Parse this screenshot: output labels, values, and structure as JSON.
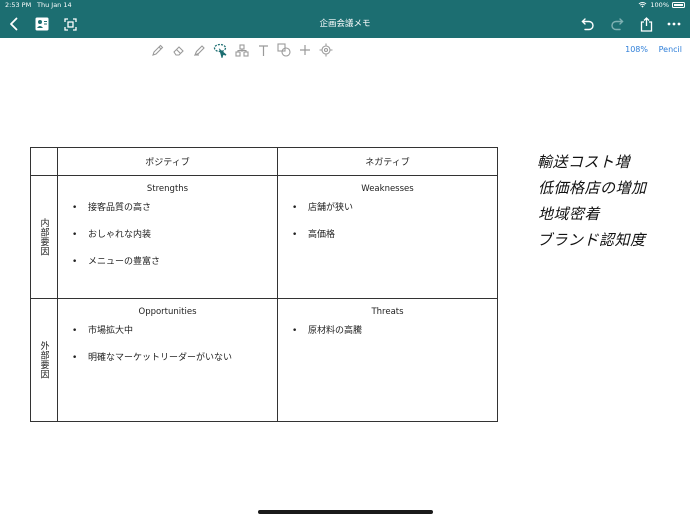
{
  "status_bar": {
    "time": "2:53 PM",
    "date": "Thu Jan 14",
    "battery": "100%"
  },
  "nav": {
    "title": "企画会議メモ",
    "icons": [
      "chevron-left-icon",
      "contacts-icon",
      "fullscreen-icon",
      "undo-icon",
      "redo-icon",
      "share-icon",
      "more-icon"
    ]
  },
  "toolbar": {
    "tools": [
      "pen-icon",
      "eraser-icon",
      "highlighter-icon",
      "lasso-icon",
      "shapes-icon",
      "text-icon",
      "sticker-icon",
      "add-icon",
      "laser-pointer-icon"
    ],
    "zoom": "108%",
    "mode": "Pencil",
    "accent": "#2f7fd9"
  },
  "colors": {
    "bar_bg": "#1c6e71"
  },
  "swot": {
    "col_headers": [
      "ポジティブ",
      "ネガティブ"
    ],
    "row_headers": [
      "内部要因",
      "外部要因"
    ],
    "strengths": {
      "title": "Strengths",
      "items": [
        "接客品質の高さ",
        "おしゃれな内装",
        "メニューの豊富さ"
      ]
    },
    "weaknesses": {
      "title": "Weaknesses",
      "items": [
        "店舗が狭い",
        "高価格"
      ]
    },
    "opportunities": {
      "title": "Opportunities",
      "items": [
        "市場拡大中",
        "明確なマーケットリーダーがいない"
      ]
    },
    "threats": {
      "title": "Threats",
      "items": [
        "原材料の高騰"
      ]
    }
  },
  "handwritten_notes": [
    "輸送コスト増",
    "低価格店の増加",
    "地域密着",
    "ブランド認知度"
  ]
}
